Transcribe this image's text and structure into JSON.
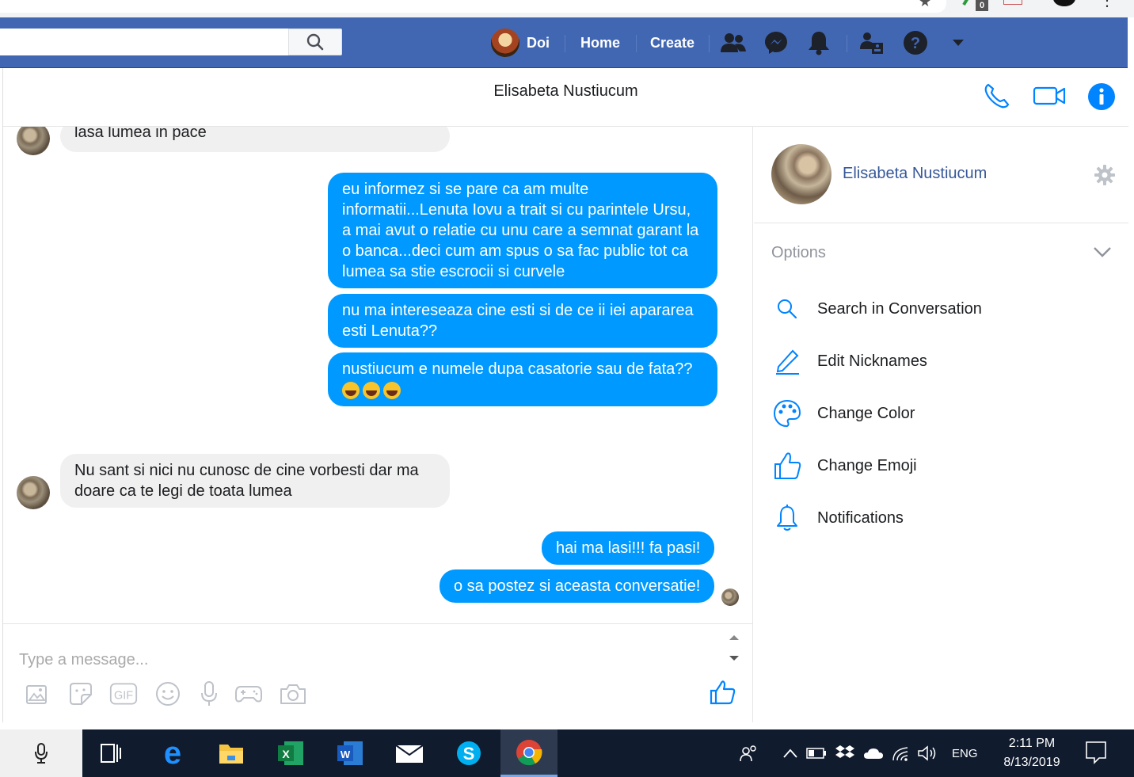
{
  "browser": {
    "url_fragment": "elisabetanustiucum",
    "extension_badge": "0"
  },
  "fb_nav": {
    "search_placeholder": "",
    "profile_name": "Doi",
    "home_label": "Home",
    "create_label": "Create"
  },
  "conversation": {
    "title": "Elisabeta Nustiucum",
    "messages": [
      {
        "from": "them",
        "text": "lasa lumea in pace"
      },
      {
        "from": "me",
        "text": "eu informez si se pare ca am multe informatii...Lenuta Iovu a trait si cu parintele Ursu, a mai avut o relatie cu unu care a semnat garant la o banca...deci cum am spus o sa fac public tot ca lumea sa stie escrocii si curvele"
      },
      {
        "from": "me",
        "text": "nu ma intereseaza cine esti si de ce ii iei apararea esti Lenuta??"
      },
      {
        "from": "me",
        "text": "nustiucum e numele dupa casatorie sau de fata??"
      },
      {
        "from": "them",
        "text": "Nu sant si nici nu cunosc de cine vorbesti dar ma doare ca te legi de toata lumea"
      },
      {
        "from": "me",
        "text": "hai ma lasi!!! fa pasi!"
      },
      {
        "from": "me",
        "text": "o sa postez si aceasta conversatie!"
      }
    ],
    "composer_placeholder": "Type a message..."
  },
  "side_panel": {
    "name": "Elisabeta Nustiucum",
    "options_label": "Options",
    "options": [
      {
        "label": "Search in Conversation",
        "icon": "search-icon"
      },
      {
        "label": "Edit Nicknames",
        "icon": "pencil-icon"
      },
      {
        "label": "Change Color",
        "icon": "palette-icon"
      },
      {
        "label": "Change Emoji",
        "icon": "thumbs-up-icon"
      },
      {
        "label": "Notifications",
        "icon": "bell-icon"
      }
    ]
  },
  "taskbar": {
    "language": "ENG",
    "time": "2:11 PM",
    "date": "8/13/2019"
  },
  "colors": {
    "fb_blue": "#4267b2",
    "bubble_out": "#0099ff",
    "bubble_in": "#f1f0f0",
    "taskbar": "#101b2e"
  }
}
